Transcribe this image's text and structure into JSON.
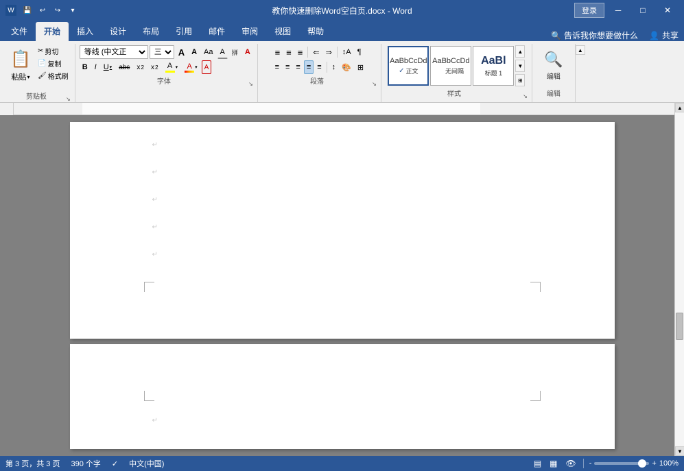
{
  "titlebar": {
    "title": "教你快速删除Word空白页.docx - Word",
    "login_label": "登录",
    "min_label": "─",
    "max_label": "□",
    "close_label": "✕",
    "save_icon": "💾",
    "undo_icon": "↩",
    "redo_icon": "↪",
    "dropdown_icon": "▾"
  },
  "ribbon": {
    "tabs": [
      {
        "label": "文件",
        "active": false
      },
      {
        "label": "开始",
        "active": true
      },
      {
        "label": "插入",
        "active": false
      },
      {
        "label": "设计",
        "active": false
      },
      {
        "label": "布局",
        "active": false
      },
      {
        "label": "引用",
        "active": false
      },
      {
        "label": "邮件",
        "active": false
      },
      {
        "label": "审阅",
        "active": false
      },
      {
        "label": "视图",
        "active": false
      },
      {
        "label": "帮助",
        "active": false
      }
    ],
    "search_placeholder": "告诉我你想要做什么",
    "share_label": "共享",
    "groups": {
      "clipboard": {
        "label": "剪贴板",
        "paste": "粘贴",
        "cut": "剪切",
        "copy": "复制",
        "format_painter": "格式刷"
      },
      "font": {
        "label": "字体",
        "font_name": "等线 (中文正",
        "font_size": "三号",
        "grow": "A",
        "shrink": "A",
        "case": "Aa",
        "clear": "A",
        "bold": "B",
        "italic": "I",
        "underline": "U",
        "strikethrough": "abc",
        "subscript": "x₂",
        "superscript": "x²",
        "highlight": "A",
        "font_color": "A"
      },
      "paragraph": {
        "label": "段落",
        "bullets": "≡",
        "numbering": "≡",
        "multilevel": "≡",
        "indent_dec": "⇐",
        "indent_inc": "⇒",
        "sort": "↕",
        "show_marks": "¶",
        "align_left": "≡",
        "align_center": "≡",
        "align_right": "≡",
        "justify": "≡",
        "col_layout": "≡",
        "line_spacing": "≡",
        "shading": "☐",
        "borders": "☐"
      },
      "styles": {
        "label": "样式",
        "items": [
          {
            "label": "正文",
            "preview": "AaBbCcDd",
            "active": true
          },
          {
            "label": "无间隔",
            "preview": "AaBbCcDd",
            "active": false
          },
          {
            "label": "标题 1",
            "preview": "AaBl",
            "active": false
          }
        ]
      },
      "editing": {
        "label": "编辑",
        "icon": "🔍",
        "label_text": "编辑"
      }
    }
  },
  "document": {
    "page_marks": [
      "↵",
      "↵",
      "↵",
      "↵",
      "↵"
    ],
    "page2_marks": [
      "↵"
    ]
  },
  "statusbar": {
    "page_info": "第 3 页，共 3 页",
    "word_count": "390 个字",
    "check_icon": "🔍",
    "lang": "中文(中国)",
    "view_modes": [
      "▤",
      "▦",
      "👁"
    ],
    "zoom_minus": "-",
    "zoom_plus": "+",
    "zoom_value": "100%"
  }
}
